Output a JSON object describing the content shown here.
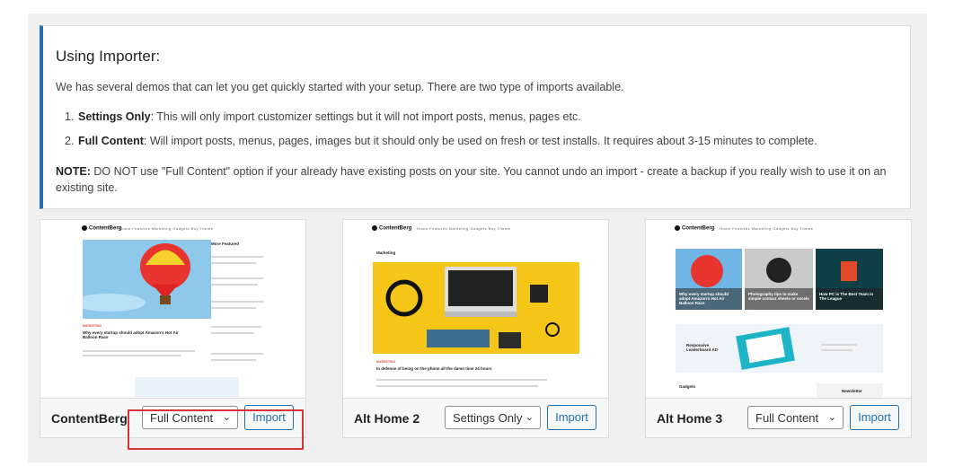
{
  "notice": {
    "title": "Using Importer:",
    "intro": "We has several demos that can let you get quickly started with your setup. There are two type of imports available.",
    "items": [
      {
        "num": "1.",
        "label": "Settings Only",
        "text": ": This will only import customizer settings but it will not import posts, menus, pages etc."
      },
      {
        "num": "2.",
        "label": "Full Content",
        "text": ": Will import posts, menus, pages, images but it should only be used on fresh or test installs. It requires about 3-15 minutes to complete."
      }
    ],
    "note_label": "NOTE:",
    "note_text": " DO NOT use \"Full Content\" option if your already have existing posts on your site. You cannot undo an import - create a backup if you really wish to use it on an existing site."
  },
  "demos": [
    {
      "name": "ContentBerg",
      "option": "Full Content",
      "import_label": "Import"
    },
    {
      "name": "Alt Home 2",
      "option": "Settings Only",
      "import_label": "Import"
    },
    {
      "name": "Alt Home 3",
      "option": "Full Content",
      "import_label": "Import"
    }
  ],
  "preview": {
    "logo": "ContentBerg",
    "nav": "Home  Features  Marketing  Gadgets  Buy Theme",
    "sidebar_title": "More Featured",
    "post1_title": "Why every startup should adopt Amazon's Hot Air Balloon Race",
    "post2_cat": "Marketing",
    "post2_title": "In defense of being on the phone all the damn time 24 hours",
    "card3_a": "Why every startup should adopt Amazon's Hot Air Balloon Race",
    "card3_b": "Photography tips to make simple contact sheets or excels",
    "card3_c": "How PC is The Best Team in The League",
    "ad_text": "Responsive Leaderboard AD",
    "gadgets": "Gadgets",
    "newsletter": "Newsletter"
  },
  "colors": {
    "accent": "#2271b1",
    "highlight": "#d63638",
    "yellow": "#f5c518",
    "sky": "#8ec9ec"
  },
  "chevron_glyph": "⌄"
}
